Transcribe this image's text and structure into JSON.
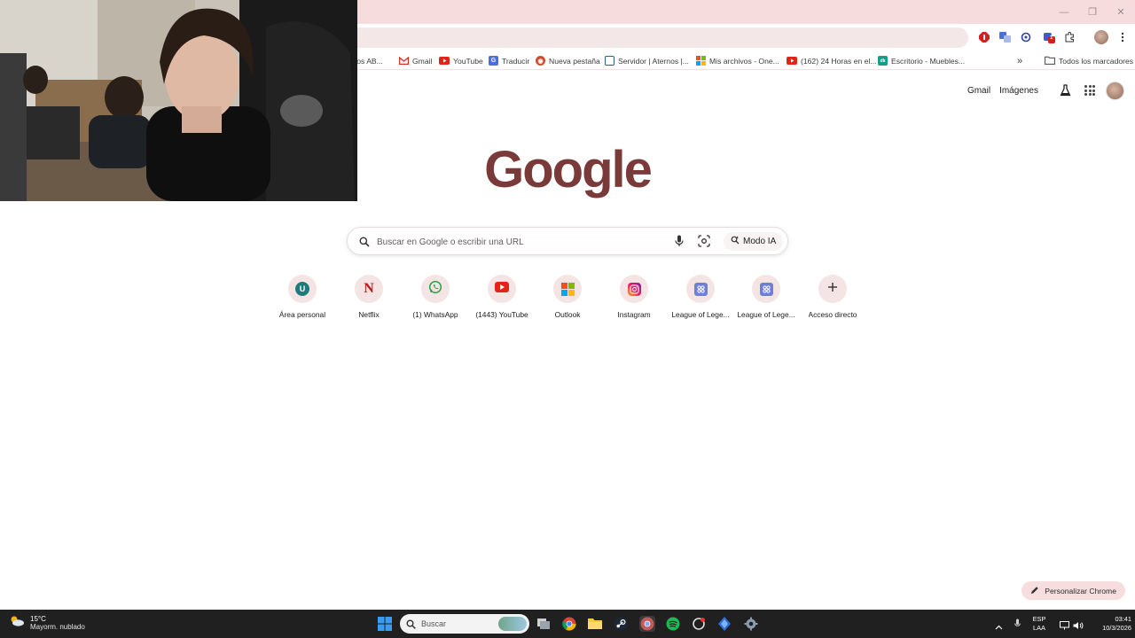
{
  "bookmarks": [
    {
      "label": "cios AB...",
      "icon": "bookmark-icon"
    },
    {
      "label": "Gmail",
      "icon": "gmail-icon"
    },
    {
      "label": "YouTube",
      "icon": "youtube-icon"
    },
    {
      "label": "Traducir",
      "icon": "translate-icon"
    },
    {
      "label": "Nueva pestaña",
      "icon": "new-tab-icon"
    },
    {
      "label": "Servidor | Aternos |...",
      "icon": "aternos-icon"
    },
    {
      "label": "Mis archivos - One...",
      "icon": "microsoft-icon"
    },
    {
      "label": "(162) 24 Horas en el...",
      "icon": "youtube-icon"
    },
    {
      "label": "Escritorio - Muebles...",
      "icon": "site-icon"
    }
  ],
  "bookmarks_overflow": "»",
  "all_bookmarks": "Todos los marcadores",
  "extension_badge": "1",
  "header": {
    "gmail": "Gmail",
    "images": "Imágenes"
  },
  "logo": "Google",
  "search": {
    "placeholder": "Buscar en Google o escribir una URL",
    "ai_mode": "Modo IA"
  },
  "shortcuts": [
    {
      "label": "Área personal",
      "icon": "u-icon",
      "letter": "U"
    },
    {
      "label": "Netflix",
      "icon": "netflix-icon",
      "letter": "N"
    },
    {
      "label": "(1) WhatsApp",
      "icon": "whatsapp-icon"
    },
    {
      "label": "(1443) YouTube",
      "icon": "youtube-icon"
    },
    {
      "label": "Outlook",
      "icon": "microsoft-icon"
    },
    {
      "label": "Instagram",
      "icon": "instagram-icon"
    },
    {
      "label": "League of Lege...",
      "icon": "league-icon"
    },
    {
      "label": "League of Lege...",
      "icon": "league-icon"
    },
    {
      "label": "Acceso directo",
      "icon": "plus-icon"
    }
  ],
  "customize": "Personalizar Chrome",
  "taskbar": {
    "weather_temp": "15°C",
    "weather_desc": "Mayorm. nublado",
    "search_placeholder": "Buscar",
    "language": "ESP",
    "layout": "LAA",
    "time": "03:41",
    "date": "10/3/2026"
  },
  "colors": {
    "accent": "#f6dcdc",
    "logo": "#7a3a3a",
    "taskbar": "#202020"
  }
}
